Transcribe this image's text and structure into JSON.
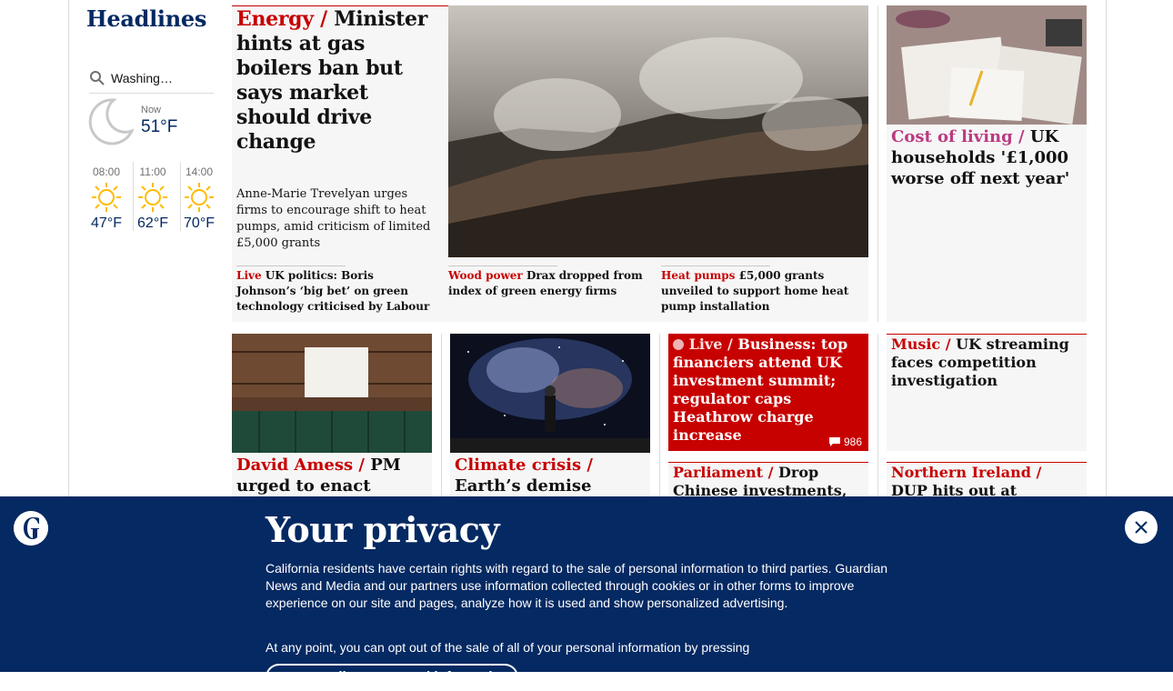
{
  "left": {
    "title": "Headlines",
    "location": "Washing…",
    "now_label": "Now",
    "now_temp": "51°F",
    "forecast": [
      {
        "time": "08:00",
        "temp": "47°F",
        "icon": "sun-icon"
      },
      {
        "time": "11:00",
        "temp": "62°F",
        "icon": "sun-icon"
      },
      {
        "time": "14:00",
        "temp": "70°F",
        "icon": "sun-icon"
      }
    ]
  },
  "main": {
    "kicker": "Energy",
    "headline": "Minister hints at gas boilers ban but says market should drive change",
    "standfirst": "Anne-Marie Trevelyan urges firms to encourage shift to heat pumps, amid criticism of limited £5,000 grants",
    "sublinks": [
      {
        "kicker": "Live",
        "text": "UK politics: Boris Johnson’s ‘big bet’ on green technology criticised by Labour"
      },
      {
        "kicker": "Wood power",
        "text": "Drax dropped from index of green energy firms"
      },
      {
        "kicker": "Heat pumps",
        "text": "£5,000 grants unveiled to support home heat pump installation"
      }
    ]
  },
  "cost_of_living": {
    "kicker": "Cost of living",
    "headline": "UK households '£1,000 worse off next year'"
  },
  "david_amess": {
    "kicker": "David Amess",
    "headline": "PM urged to enact ‘David’s"
  },
  "climate": {
    "kicker": "Climate crisis",
    "headline": "Earth’s demise could rid"
  },
  "business": {
    "kicker": "Live",
    "headline": "Business: top financiers attend UK investment summit; regulator caps Heathrow charge increase",
    "comments": "986"
  },
  "music": {
    "kicker": "Music",
    "headline": "UK streaming faces competition investigation"
  },
  "parliament": {
    "kicker": "Parliament",
    "headline": "Drop Chinese investments, MPs and"
  },
  "ni": {
    "kicker": "Northern Ireland",
    "headline": "DUP hits out at prosecution of"
  },
  "privacy": {
    "title": "Your privacy",
    "text": "California residents have certain rights with regard to the sale of personal information to third parties. Guardian News and Media and our partners use information collected through cookies or in other forms to improve experience on our site and pages, analyze how it is used and show personalized advertising.",
    "text2": "At any point, you can opt out of the sale of all of your personal information by pressing",
    "button": "Do not sell my personal information"
  },
  "colors": {
    "red": "#c70000",
    "navy": "#052962",
    "live_bg": "#c70000"
  }
}
